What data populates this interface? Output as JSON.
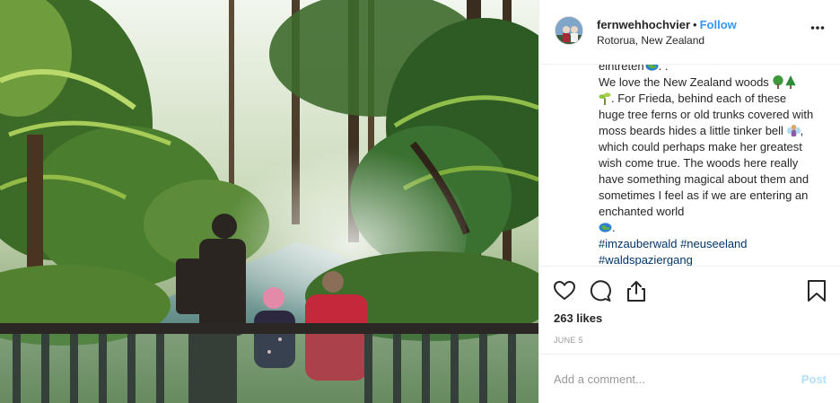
{
  "header": {
    "username": "fernwehhochvier",
    "separator": "•",
    "follow_label": "Follow",
    "location": "Rotorua, New Zealand"
  },
  "caption": {
    "line_top": "eintreten",
    "line_top_suffix": ". .",
    "body_1": "We love the New Zealand woods",
    "body_2": ". For Frieda, behind each of these huge tree ferns or old trunks covered with moss beards hides a little tinker bell",
    "body_3": ", which could perhaps make her greatest wish come true. The woods here really have something magical about them and sometimes I feel as if we are entering an enchanted world",
    "hashtags": [
      "#imzauberwald",
      "#neuseeland",
      "#waldspaziergang"
    ]
  },
  "actions": {
    "likes": "263 likes",
    "date": "JUNE 5"
  },
  "comment": {
    "placeholder": "Add a comment...",
    "post_label": "Post"
  },
  "colors": {
    "link": "#3897f0",
    "hashtag": "#003569",
    "post_disabled": "#b2dffc",
    "muted": "#999999"
  },
  "icons": [
    "heart-icon",
    "comment-icon",
    "share-icon",
    "bookmark-icon",
    "more-options-icon",
    "globe-emoji-icon",
    "tree-emoji-icon",
    "sprout-emoji-icon",
    "fairy-emoji-icon"
  ]
}
